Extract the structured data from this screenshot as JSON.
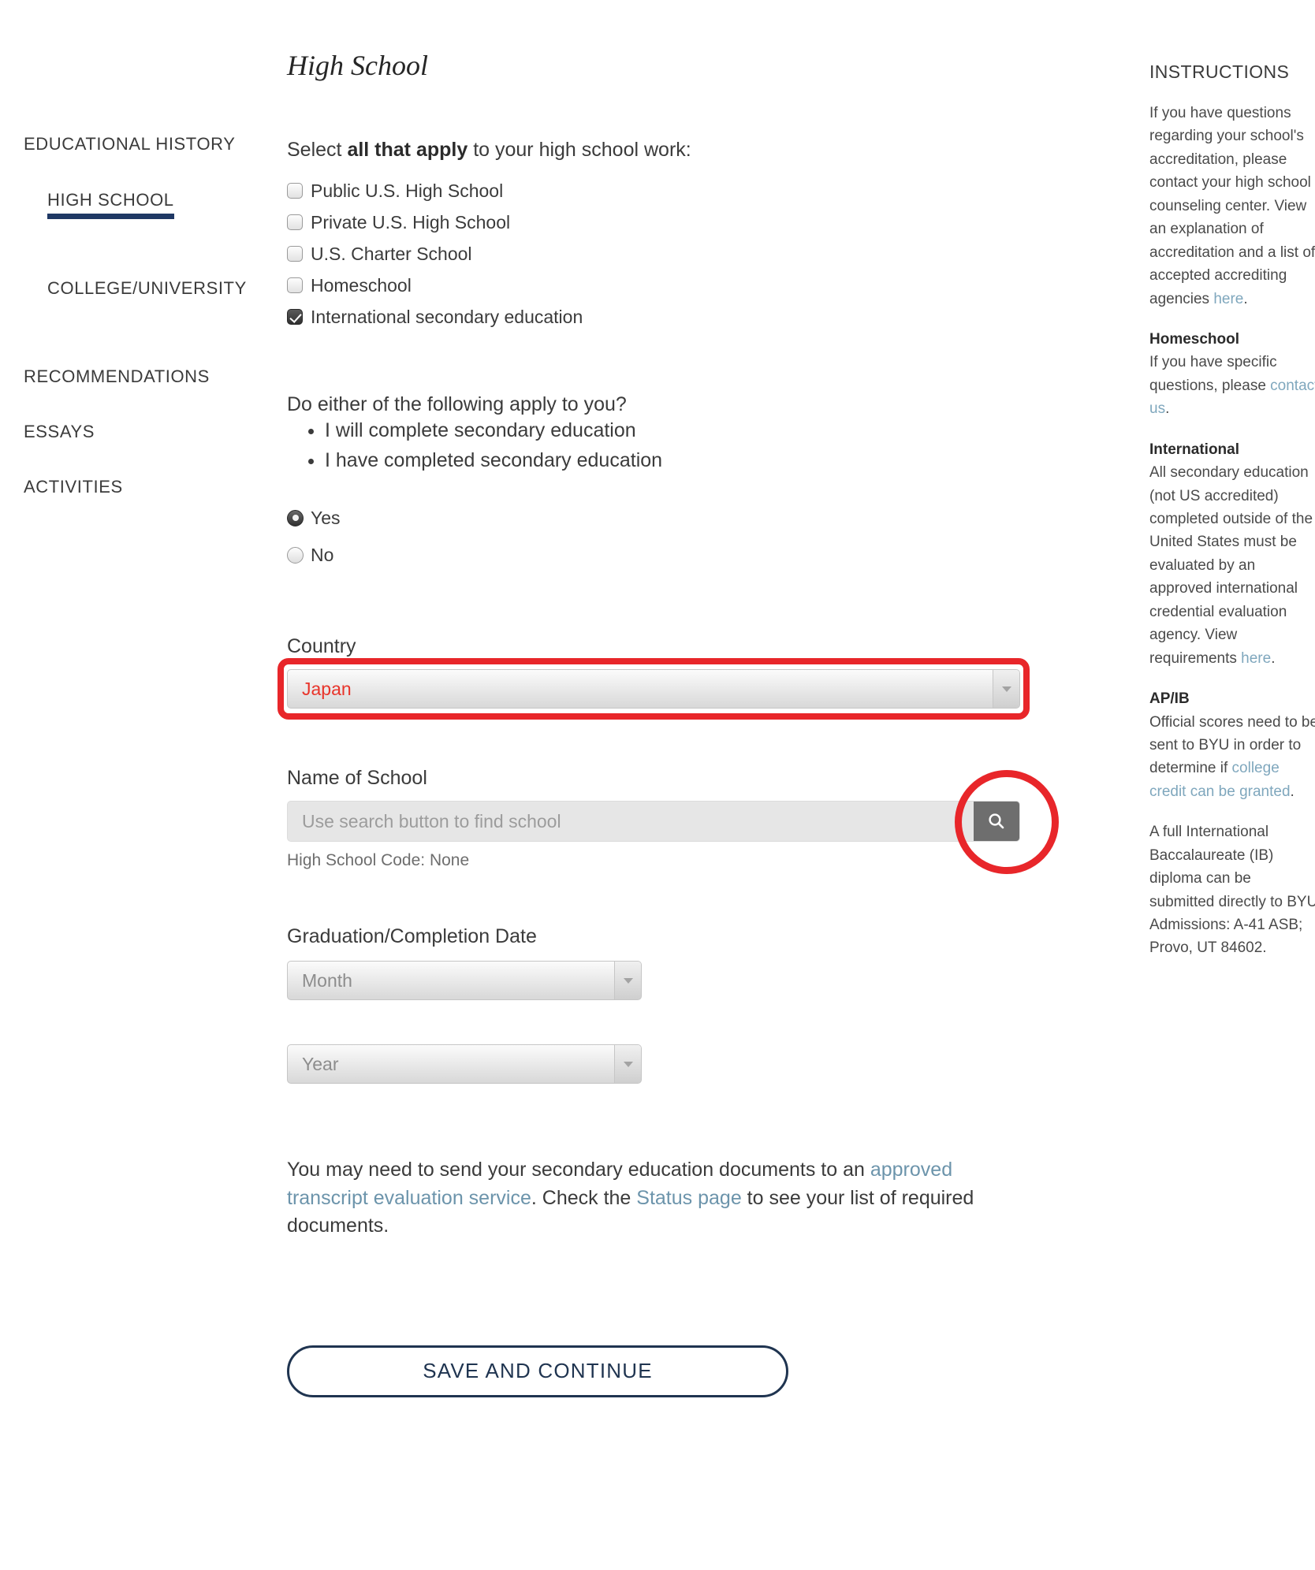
{
  "page": {
    "title": "High School"
  },
  "sidebar": {
    "sections": [
      {
        "label": "EDUCATIONAL HISTORY",
        "children": [
          {
            "label": "HIGH SCHOOL",
            "active": true
          },
          {
            "label": "COLLEGE/UNIVERSITY",
            "active": false
          }
        ]
      },
      {
        "label": "RECOMMENDATIONS"
      },
      {
        "label": "ESSAYS"
      },
      {
        "label": "ACTIVITIES"
      }
    ]
  },
  "form": {
    "prompt_before": "Select ",
    "prompt_bold": "all that apply",
    "prompt_after": " to your high school work:",
    "checkboxes": [
      {
        "label": "Public U.S. High School",
        "checked": false
      },
      {
        "label": "Private U.S. High School",
        "checked": false
      },
      {
        "label": "U.S. Charter School",
        "checked": false
      },
      {
        "label": "Homeschool",
        "checked": false
      },
      {
        "label": "International secondary education",
        "checked": true
      }
    ],
    "question": "Do either of the following apply to you?",
    "bullets": [
      "I will complete secondary education",
      "I have completed secondary education"
    ],
    "radios": [
      {
        "label": "Yes",
        "selected": true
      },
      {
        "label": "No",
        "selected": false
      }
    ],
    "country_label": "Country",
    "country_value": "Japan",
    "school_label": "Name of School",
    "school_placeholder": "Use search button to find school",
    "school_value": "",
    "search_icon": "search-icon",
    "hs_code": "High School Code: None",
    "grad_label": "Graduation/Completion Date",
    "month_placeholder": "Month",
    "year_placeholder": "Year",
    "note": {
      "t1": "You may need to send your secondary education documents to an ",
      "link1": "approved transcript evaluation service",
      "t2": ". Check the ",
      "link2": "Status page",
      "t3": " to see your list of required documents."
    },
    "save_label": "SAVE AND CONTINUE"
  },
  "instructions": {
    "title": "INSTRUCTIONS",
    "intro": {
      "t1": "If you have questions regarding your school's accreditation, please contact your high school counseling center. View an explanation of accreditation and a list of accepted accrediting agencies ",
      "link": "here",
      "t2": "."
    },
    "homeschool": {
      "head": "Homeschool",
      "t1": "If you have specific questions, please ",
      "link": "contact us",
      "t2": "."
    },
    "international": {
      "head": "International",
      "t1": "All secondary education (not US accredited) completed outside of the United States must be evaluated by an approved international credential evaluation agency. View requirements ",
      "link": "here",
      "t2": "."
    },
    "apib": {
      "head": "AP/IB",
      "t1": "Official scores need to be sent to BYU in order to determine if ",
      "link": "college credit can be granted",
      "t2": "."
    },
    "ib_par": "A full International Baccalaureate (IB) diploma can be submitted directly to BYU Admissions: A-41 ASB; Provo, UT 84602."
  },
  "colors": {
    "accent_navy": "#1f3864",
    "highlight_red": "#e8262a",
    "link_blue": "#6c94ab",
    "value_red": "#e8342a"
  }
}
